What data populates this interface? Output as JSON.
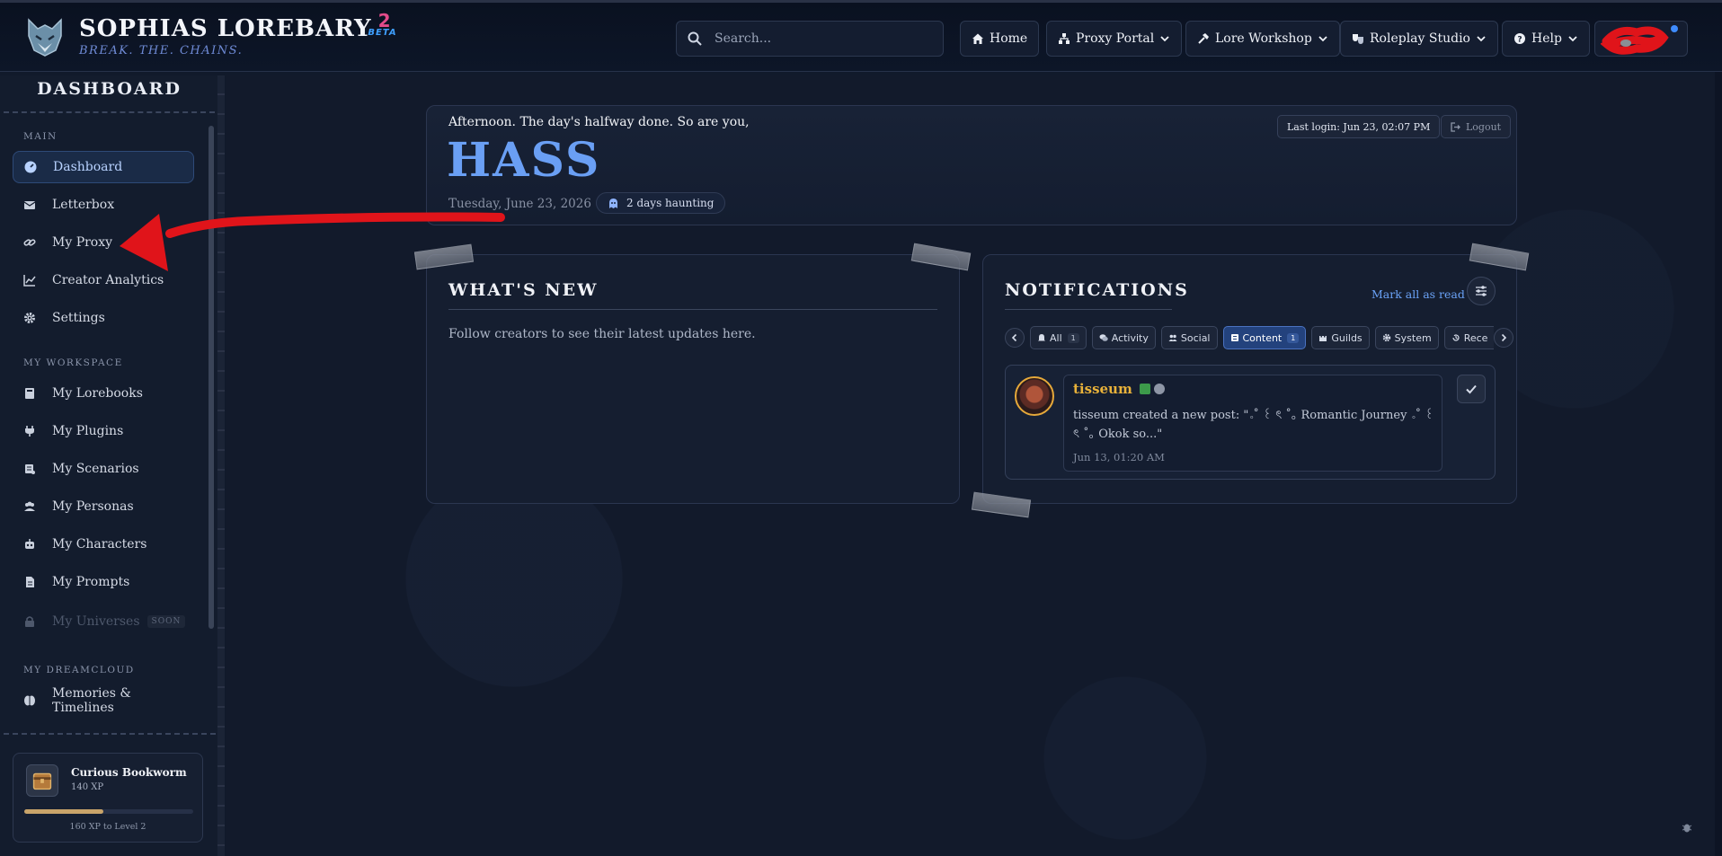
{
  "brand": {
    "title": "SOPHIAS LOREBARY",
    "version": "2",
    "beta": "BETA",
    "tagline": "BREAK. THE. CHAINS."
  },
  "search": {
    "placeholder": "Search..."
  },
  "nav": [
    {
      "label": "Home",
      "icon": "home-icon"
    },
    {
      "label": "Proxy Portal",
      "icon": "network-icon"
    },
    {
      "label": "Lore Workshop",
      "icon": "hammer-icon"
    },
    {
      "label": "Roleplay Studio",
      "icon": "masks-icon"
    },
    {
      "label": "Help",
      "icon": "help-circle-icon"
    }
  ],
  "sidebar": {
    "title": "DASHBOARD",
    "sections": [
      {
        "label": "MAIN",
        "items": [
          {
            "label": "Dashboard",
            "icon": "gauge-icon",
            "active": true
          },
          {
            "label": "Letterbox",
            "icon": "envelope-icon"
          },
          {
            "label": "My Proxy",
            "icon": "link-icon"
          },
          {
            "label": "Creator Analytics",
            "icon": "chart-line-icon"
          },
          {
            "label": "Settings",
            "icon": "gear-icon"
          }
        ]
      },
      {
        "label": "MY WORKSPACE",
        "items": [
          {
            "label": "My Lorebooks",
            "icon": "book-icon"
          },
          {
            "label": "My Plugins",
            "icon": "plug-icon"
          },
          {
            "label": "My Scenarios",
            "icon": "scroll-icon"
          },
          {
            "label": "My Personas",
            "icon": "users-icon"
          },
          {
            "label": "My Characters",
            "icon": "robot-icon"
          },
          {
            "label": "My Prompts",
            "icon": "file-icon"
          },
          {
            "label": "My Universes",
            "icon": "lock-icon",
            "disabled": true,
            "badge": "SOON"
          }
        ]
      },
      {
        "label": "MY DREAMCLOUD",
        "items": [
          {
            "label": "Memories & Timelines",
            "icon": "brain-icon"
          }
        ]
      }
    ],
    "xp": {
      "name": "Curious Bookworm",
      "points": "140 XP",
      "next": "160 XP to Level 2",
      "progress": 0.47
    }
  },
  "hero": {
    "greeting": "Afternoon. The day's halfway done. So are you,",
    "name": "HASS",
    "date": "Tuesday, June 23, 2026",
    "haunting": "2 days haunting",
    "last_login": "Last login: Jun 23, 02:07 PM",
    "logout": "Logout"
  },
  "whats_new": {
    "title": "WHAT'S NEW",
    "empty_text": "Follow creators to see their latest updates here."
  },
  "notifications": {
    "title": "NOTIFICATIONS",
    "mark_all": "Mark all as read",
    "tabs": [
      {
        "label": "All",
        "count": "1",
        "icon": "bell-icon"
      },
      {
        "label": "Activity",
        "icon": "comments-icon"
      },
      {
        "label": "Social",
        "icon": "users-icon"
      },
      {
        "label": "Content",
        "count": "1",
        "icon": "list-icon",
        "active": true
      },
      {
        "label": "Guilds",
        "icon": "castle-icon"
      },
      {
        "label": "System",
        "icon": "gear-icon"
      },
      {
        "label": "Rece",
        "icon": "history-icon"
      }
    ],
    "items": [
      {
        "user": "tisseum",
        "text": "tisseum created a new post: \"｡˚ ꒰ ৎ ˚｡ Romantic Journey ｡˚ ꒰ ৎ ˚｡ Okok so...\"",
        "time": "Jun 13, 01:20 AM"
      }
    ]
  },
  "colors": {
    "accent": "#6a9ff4",
    "gold": "#e9b23a",
    "active_tab": "#23427d",
    "annotation": "#e0141a"
  }
}
